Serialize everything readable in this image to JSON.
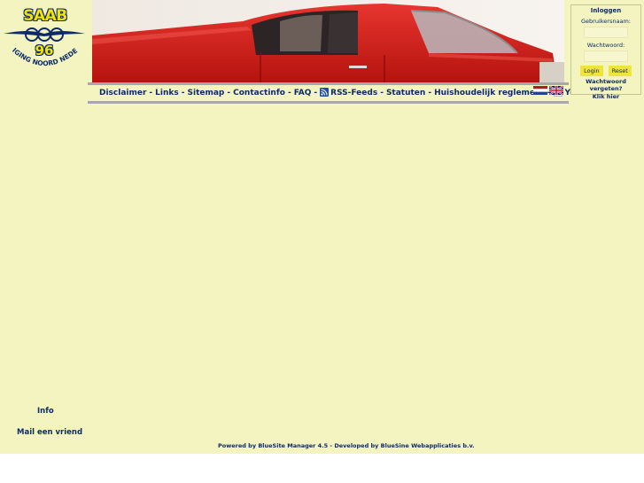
{
  "logo": {
    "brand": "SAAB",
    "number": "96",
    "arc_text": "VERENIGING NOORD NEDERLAND"
  },
  "nav": {
    "items": [
      "Disclaimer",
      "Links",
      "Sitemap",
      "Contactinfo",
      "FAQ",
      "RSS-Feeds",
      "Statuten",
      "Huishoudelijk reglement",
      "YouTube"
    ],
    "separator": "-"
  },
  "login": {
    "title": "Inloggen",
    "username_label": "Gebruikersnaam:",
    "password_label": "Wachtwoord:",
    "login_button": "Login",
    "reset_button": "Reset",
    "forgot_line1": "Wachtwoord vergeten?",
    "forgot_line2": "Klik hier"
  },
  "sidebar": {
    "info": "Info",
    "mail_friend": "Mail een vriend"
  },
  "footer": {
    "text": "Powered by BlueSite Manager 4.5   -   Developed by BlueSine Webapplicaties b.v."
  },
  "colors": {
    "background": "#f3f4c0",
    "text": "#0d2b6b",
    "car": "#d41f1f",
    "nav_rule": "#a8a8a8",
    "button": "#efe43a"
  }
}
